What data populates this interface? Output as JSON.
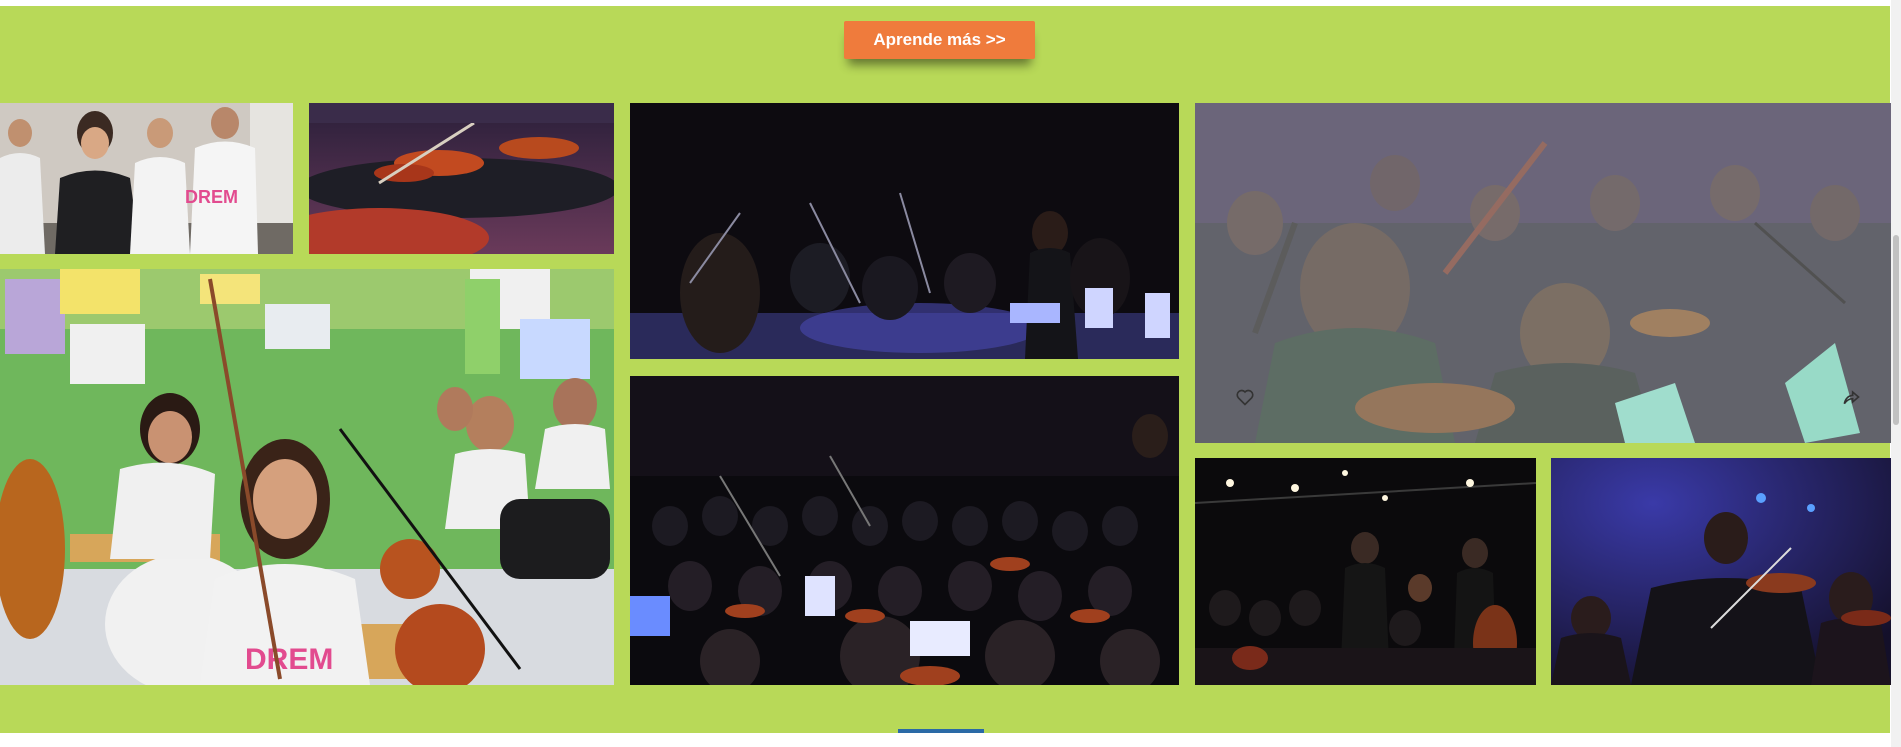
{
  "cta": {
    "label": "Aprende más >>"
  },
  "colors": {
    "background": "#b8d958",
    "cta": "#ef7b3c",
    "indicator": "#2a6aa6"
  },
  "gallery": {
    "items": [
      {
        "id": "teacher-students",
        "icons": []
      },
      {
        "id": "violins-on-chairs",
        "icons": []
      },
      {
        "id": "conductor-stage",
        "icons": []
      },
      {
        "id": "orchestra-closeup-hovered",
        "icons": [
          "heart-icon",
          "share-icon"
        ]
      },
      {
        "id": "classroom-violin-girl",
        "icons": []
      },
      {
        "id": "full-orchestra",
        "icons": []
      },
      {
        "id": "orchestra-bowing",
        "icons": []
      },
      {
        "id": "violinist-purple-light",
        "icons": []
      }
    ]
  }
}
